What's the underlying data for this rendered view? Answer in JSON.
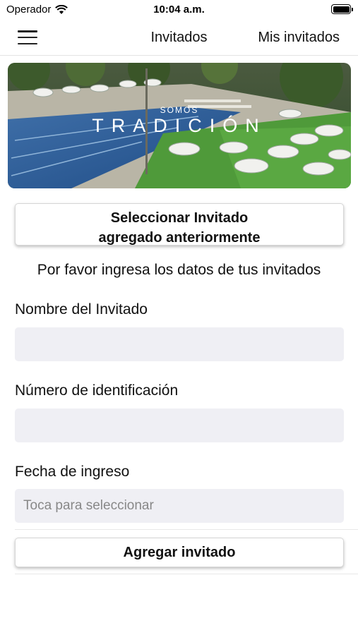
{
  "status_bar": {
    "carrier": "Operador",
    "time": "10:04 a.m."
  },
  "nav": {
    "title": "Invitados",
    "right_link": "Mis invitados"
  },
  "banner": {
    "small_text": "SOMOS",
    "big_text": "TRADICIÓN"
  },
  "select_previous_button": {
    "line1": "Seleccionar Invitado",
    "line2": "agregado anteriormente"
  },
  "prompt": "Por favor ingresa los datos de tus invitados",
  "form": {
    "name_label": "Nombre del Invitado",
    "name_value": "",
    "id_label": "Número de identificación",
    "id_value": "",
    "date_label": "Fecha de ingreso",
    "date_placeholder": "Toca para seleccionar"
  },
  "add_button": "Agregar invitado"
}
